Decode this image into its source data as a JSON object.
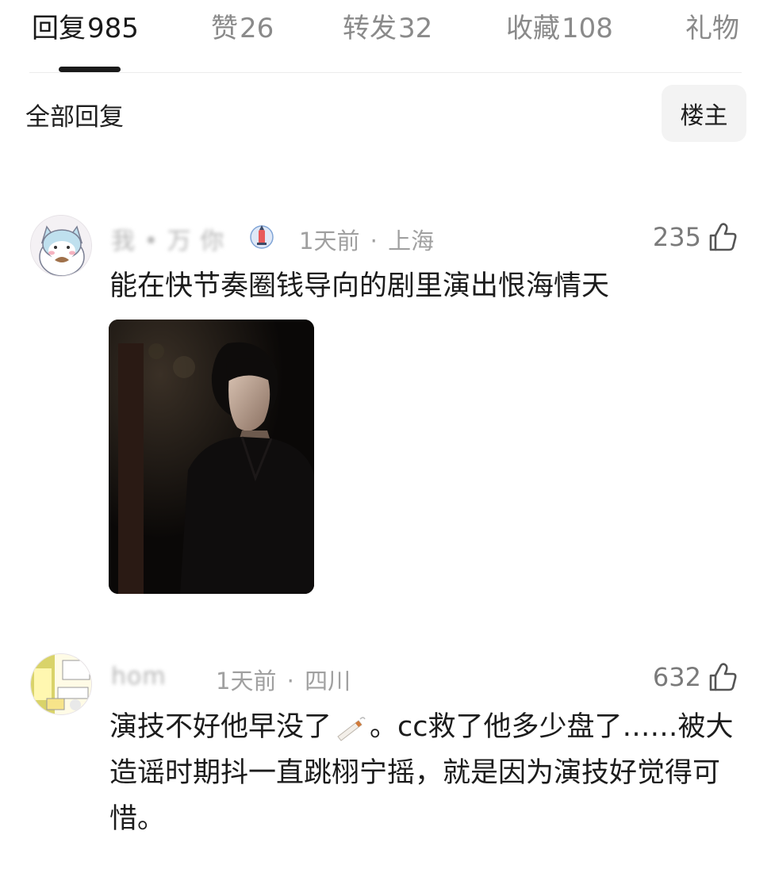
{
  "tabs": [
    {
      "label": "回复",
      "count": "985",
      "active": true
    },
    {
      "label": "赞",
      "count": "26",
      "active": false
    },
    {
      "label": "转发",
      "count": "32",
      "active": false
    },
    {
      "label": "收藏",
      "count": "108",
      "active": false
    },
    {
      "label": "礼物",
      "count": "",
      "active": false
    }
  ],
  "filter": {
    "label": "全部回复",
    "op_button": "楼主"
  },
  "comments": [
    {
      "username": "我 • 万 你",
      "time": "1天前",
      "separator": "·",
      "location": "上海",
      "likes": "235",
      "text": "能在快节奏圈钱导向的剧里演出恨海情天",
      "has_photo": true,
      "avatar_icon": "cartoon-cat-avatar-icon"
    },
    {
      "username": "hom",
      "time": "1天前",
      "separator": "·",
      "location": "四川",
      "likes": "632",
      "text_part1": "演技不好他早没了",
      "text_part2": "。cc救了他多少盘了……被大造谣时期抖一直跳栩宁摇，就是因为演技好觉得可惜。",
      "avatar_icon": "comic-avatar-icon"
    }
  ],
  "colors": {
    "accent": "#1a1a1a",
    "muted": "#a0a0a0",
    "badge": "#e85a5a"
  }
}
